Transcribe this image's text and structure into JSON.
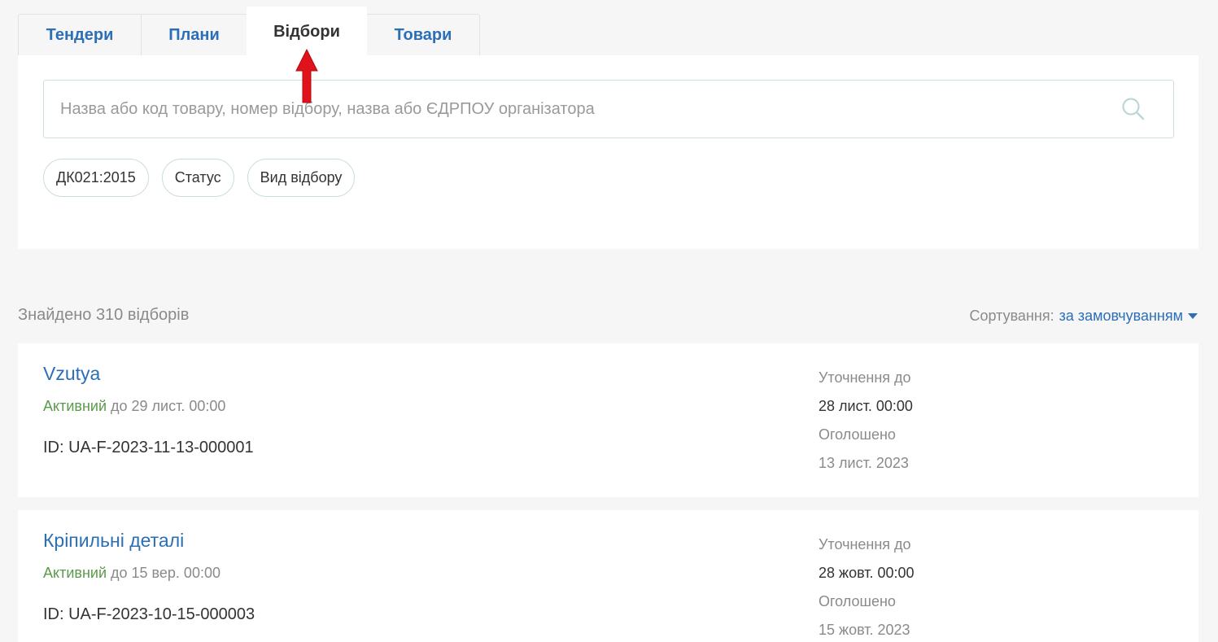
{
  "tabs": [
    {
      "label": "Тендери",
      "active": false
    },
    {
      "label": "Плани",
      "active": false
    },
    {
      "label": "Відбори",
      "active": true
    },
    {
      "label": "Товари",
      "active": false
    }
  ],
  "search": {
    "placeholder": "Назва або код товару, номер відбору, назва або ЄДРПОУ організатора",
    "value": ""
  },
  "filters": [
    "ДК021:2015",
    "Статус",
    "Вид відбору"
  ],
  "results": {
    "found_text": "Знайдено 310 відборів",
    "sort_label": "Сортування:",
    "sort_value": "за замовчуванням"
  },
  "cards": [
    {
      "title": "Vzutya",
      "status": "Активний",
      "status_suffix": "до 29 лист. 00:00",
      "id": "ID: UA-F-2023-11-13-000001",
      "clarify_label": "Уточнення до",
      "clarify_value": "28 лист. 00:00",
      "announced_label": "Оголошено",
      "announced_value": "13 лист. 2023"
    },
    {
      "title": "Кріпильні деталі",
      "status": "Активний",
      "status_suffix": "до 15 вер. 00:00",
      "id": "ID: UA-F-2023-10-15-000003",
      "clarify_label": "Уточнення до",
      "clarify_value": "28 жовт. 00:00",
      "announced_label": "Оголошено",
      "announced_value": "15 жовт. 2023"
    }
  ],
  "colors": {
    "accent": "#2c6fb6",
    "active_status": "#5a9a4a",
    "annotation_arrow": "#e0121b"
  },
  "icons": {
    "search": "search-icon",
    "sort_caret": "caret-down-icon",
    "annotation": "red-up-arrow-icon"
  }
}
